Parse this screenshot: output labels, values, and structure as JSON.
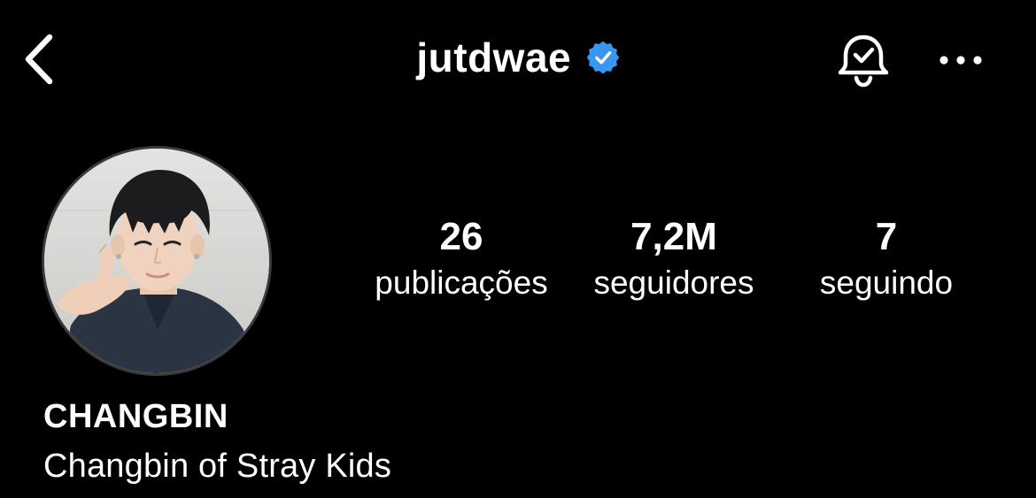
{
  "header": {
    "username": "jutdwae",
    "verified": true,
    "icons": {
      "back": "chevron-left-icon",
      "verified": "verified-badge-icon",
      "notifications": "bell-check-icon",
      "more": "more-horizontal-icon"
    }
  },
  "profile": {
    "avatar": "profile-photo",
    "stats": {
      "posts": {
        "value": "26",
        "label": "publicações"
      },
      "followers": {
        "value": "7,2M",
        "label": "seguidores"
      },
      "following": {
        "value": "7",
        "label": "seguindo"
      }
    },
    "display_name": "CHANGBIN",
    "bio": "Changbin of Stray Kids"
  },
  "colors": {
    "background": "#000000",
    "text": "#ffffff",
    "verified_badge": "#3897f0"
  }
}
